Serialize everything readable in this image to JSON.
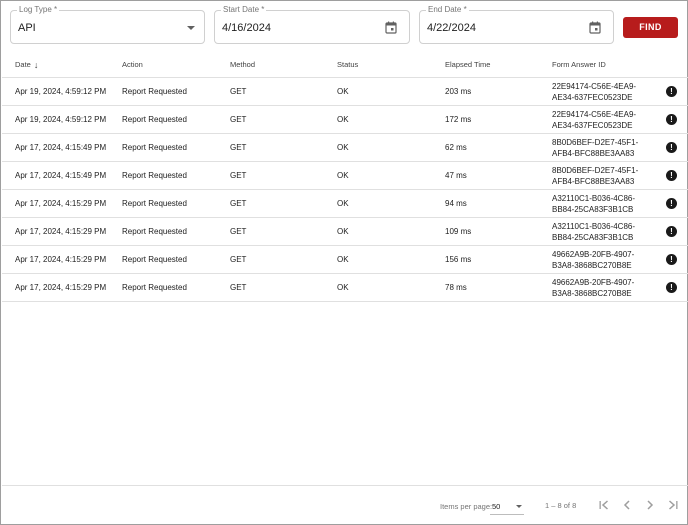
{
  "filters": {
    "log_type": {
      "label": "Log Type *",
      "value": "API"
    },
    "start_date": {
      "label": "Start Date *",
      "value": "4/16/2024"
    },
    "end_date": {
      "label": "End Date *",
      "value": "4/22/2024"
    },
    "find_label": "FIND"
  },
  "table": {
    "columns": [
      "Date",
      "Action",
      "Method",
      "Status",
      "Elapsed Time",
      "Form Answer ID"
    ],
    "rows": [
      {
        "date": "Apr 19, 2024, 4:59:12 PM",
        "action": "Report Requested",
        "method": "GET",
        "status": "OK",
        "elapsed": "203 ms",
        "fid1": "22E94174-C56E-4EA9-",
        "fid2": "AE34-637FEC0523DE"
      },
      {
        "date": "Apr 19, 2024, 4:59:12 PM",
        "action": "Report Requested",
        "method": "GET",
        "status": "OK",
        "elapsed": "172 ms",
        "fid1": "22E94174-C56E-4EA9-",
        "fid2": "AE34-637FEC0523DE"
      },
      {
        "date": "Apr 17, 2024, 4:15:49 PM",
        "action": "Report Requested",
        "method": "GET",
        "status": "OK",
        "elapsed": "62 ms",
        "fid1": "8B0D6BEF-D2E7-45F1-",
        "fid2": "AFB4-BFC88BE3AA83"
      },
      {
        "date": "Apr 17, 2024, 4:15:49 PM",
        "action": "Report Requested",
        "method": "GET",
        "status": "OK",
        "elapsed": "47 ms",
        "fid1": "8B0D6BEF-D2E7-45F1-",
        "fid2": "AFB4-BFC88BE3AA83"
      },
      {
        "date": "Apr 17, 2024, 4:15:29 PM",
        "action": "Report Requested",
        "method": "GET",
        "status": "OK",
        "elapsed": "94 ms",
        "fid1": "A32110C1-B036-4C86-",
        "fid2": "BB84-25CA83F3B1CB"
      },
      {
        "date": "Apr 17, 2024, 4:15:29 PM",
        "action": "Report Requested",
        "method": "GET",
        "status": "OK",
        "elapsed": "109 ms",
        "fid1": "A32110C1-B036-4C86-",
        "fid2": "BB84-25CA83F3B1CB"
      },
      {
        "date": "Apr 17, 2024, 4:15:29 PM",
        "action": "Report Requested",
        "method": "GET",
        "status": "OK",
        "elapsed": "156 ms",
        "fid1": "49662A9B-20FB-4907-",
        "fid2": "B3A8-3868BC270B8E"
      },
      {
        "date": "Apr 17, 2024, 4:15:29 PM",
        "action": "Report Requested",
        "method": "GET",
        "status": "OK",
        "elapsed": "78 ms",
        "fid1": "49662A9B-20FB-4907-",
        "fid2": "B3A8-3868BC270B8E"
      }
    ],
    "error_icon": "exclamation-circle-icon"
  },
  "paginator": {
    "items_label": "Items per page:",
    "page_size": "50",
    "range": "1 – 8 of 8"
  },
  "colors": {
    "accent": "#b71c1c"
  }
}
